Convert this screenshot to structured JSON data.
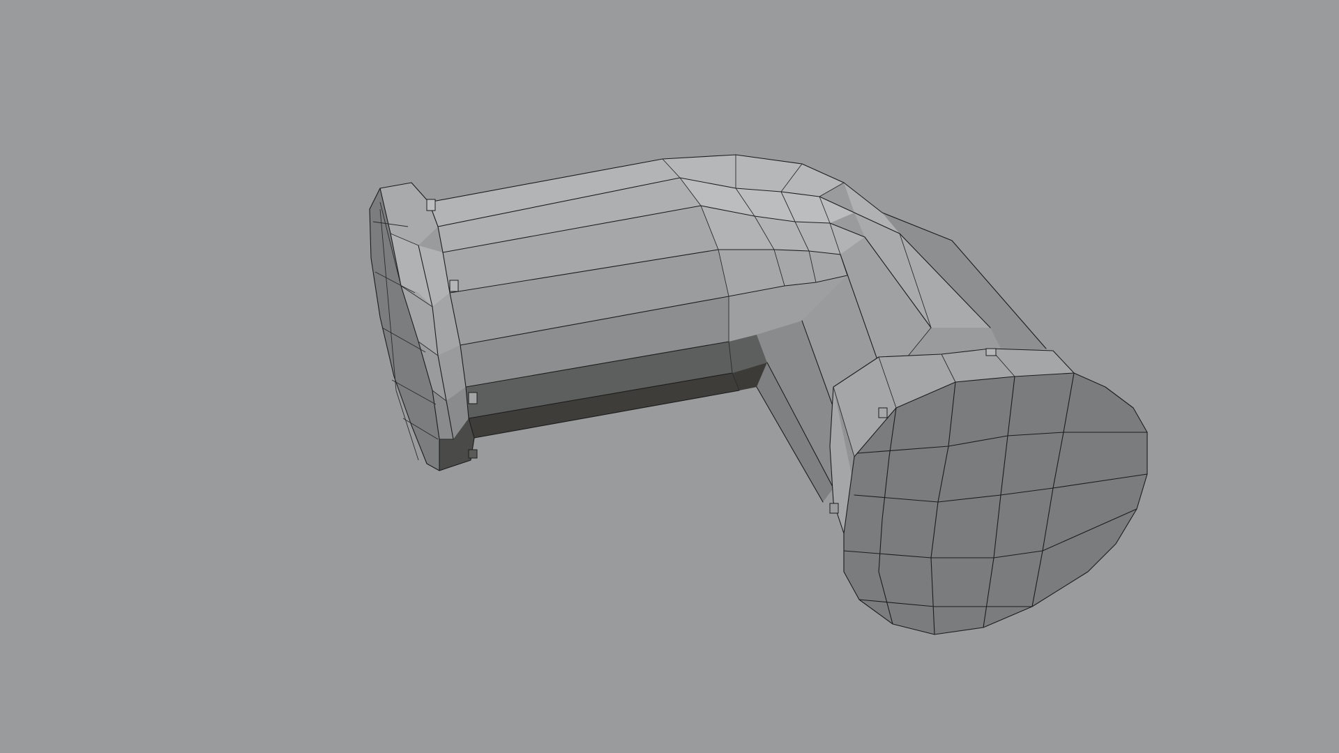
{
  "viewport": {
    "background_color": "#9a9b9d",
    "object": "pipe-elbow-mesh",
    "shading": "flat-gray-with-wireframe-edges",
    "colors": {
      "face_light": "#b9babb",
      "face_mid": "#a3a4a5",
      "face_side": "#8f9091",
      "face_dark": "#5b5c5c",
      "face_darkest": "#3c3b38",
      "end_cap": "#7c7d7e",
      "wire": "#1c1c1c"
    }
  }
}
